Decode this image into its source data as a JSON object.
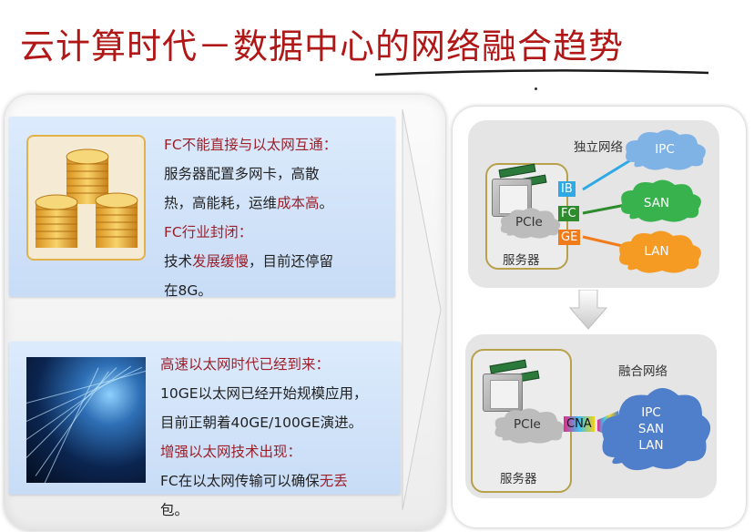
{
  "title": "云计算时代－数据中心的网络融合趋势",
  "card1": {
    "line1": "FC不能直接与以太网互通：",
    "line2": "服务器配置多网卡，高散",
    "line3_a": "热，高能耗，运维",
    "line3_b": "成本高",
    "line3_c": "。",
    "line4": "FC行业封闭：",
    "line5_a": "技术",
    "line5_b": "发展缓慢",
    "line5_c": "，目前还停留",
    "line6": "在8G。"
  },
  "card2": {
    "line1": "高速以太网时代已经到来：",
    "line2": "10GE以太网已经开始规模应用，",
    "line3": "目前正朝着40GE/100GE演进。",
    "line4": "增强以太网技术出现：",
    "line5_a": "FC在以太网传输可以确保",
    "line5_b": "无丢",
    "line6": "包。"
  },
  "diagram_top": {
    "label": "独立网络",
    "server_label": "服务器",
    "pcie": "PCIe",
    "ports": [
      "IB",
      "FC",
      "GE"
    ],
    "clouds": [
      "IPC",
      "SAN",
      "LAN"
    ]
  },
  "diagram_bottom": {
    "label": "融合网络",
    "server_label": "服务器",
    "pcie": "PCIe",
    "port": "CNA",
    "cloud_lines": [
      "IPC",
      "SAN",
      "LAN"
    ]
  },
  "colors": {
    "title": "#b01818",
    "highlight": "#9c1f2a",
    "card_bg": "#d3e4fa",
    "ib": "#2ea9e6",
    "fc": "#2e8b2e",
    "ge": "#f07b1a",
    "ipc_cloud": "#7fb3e6",
    "san_cloud": "#37b24d",
    "lan_cloud": "#f59a23",
    "converged_cloud": "#4f7ecb"
  },
  "icons": [
    "coin-stack-image",
    "optical-fiber-image",
    "cpu-chip-icon",
    "ram-module-icon",
    "cloud-icon",
    "down-arrow-icon",
    "right-arrow-icon"
  ]
}
